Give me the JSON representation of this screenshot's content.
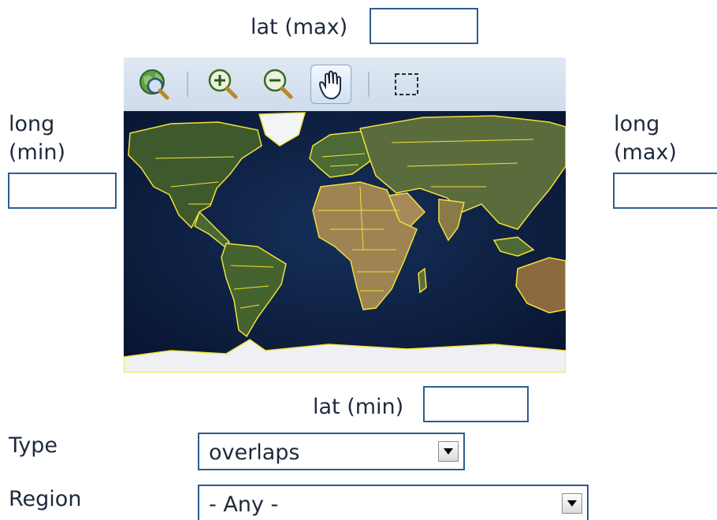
{
  "form": {
    "lat_max_label": "lat (max)",
    "lat_min_label": "lat (min)",
    "long_min_label": [
      "long",
      "(min)"
    ],
    "long_max_label": [
      "long",
      "(max)"
    ],
    "lat_max_value": "",
    "lat_min_value": "",
    "long_min_value": "",
    "long_max_value": ""
  },
  "map_toolbar": {
    "tools": [
      "zoom-to-world-icon",
      "zoom-in-icon",
      "zoom-out-icon",
      "pan-hand-icon",
      "box-select-icon"
    ],
    "active_tool": "pan-hand-icon"
  },
  "filters": {
    "type_label": "Type",
    "type_value": "overlaps",
    "region_label": "Region",
    "region_value": "- Any -"
  },
  "colors": {
    "border": "#2d5d90",
    "text": "#1d2a3c",
    "toolbar": "#d6e1ee",
    "ocean": "#0c1c3a",
    "borders_yellow": "#f2e23a"
  }
}
